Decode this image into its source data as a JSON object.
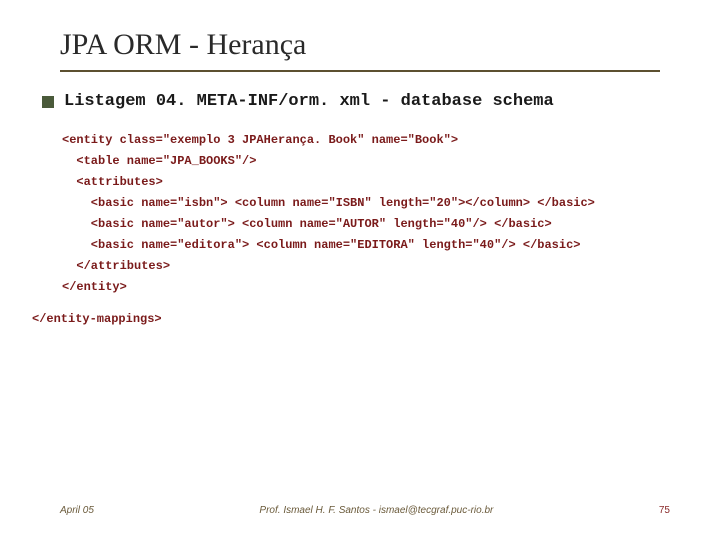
{
  "title": "JPA ORM - Herança",
  "subtitle": "Listagem 04. META-INF/orm. xml - database schema",
  "code": {
    "l1": "<entity class=\"exemplo 3 JPAHerança. Book\" name=\"Book\">",
    "l2": "  <table name=\"JPA_BOOKS\"/>",
    "l3": "  <attributes>",
    "l4": "    <basic name=\"isbn\"> <column name=\"ISBN\" length=\"20\"></column> </basic>",
    "l5": "    <basic name=\"autor\"> <column name=\"AUTOR\" length=\"40\"/> </basic>",
    "l6": "    <basic name=\"editora\"> <column name=\"EDITORA\" length=\"40\"/> </basic>",
    "l7": "  </attributes>",
    "l8": "</entity>",
    "closing": "</entity-mappings>"
  },
  "footer": {
    "left": "April 05",
    "center": "Prof. Ismael H. F. Santos - ismael@tecgraf.puc-rio.br",
    "right": "75"
  },
  "colors": {
    "underline": "#5c5030",
    "bullet": "#4a5a3a",
    "code": "#7a1a1a"
  }
}
